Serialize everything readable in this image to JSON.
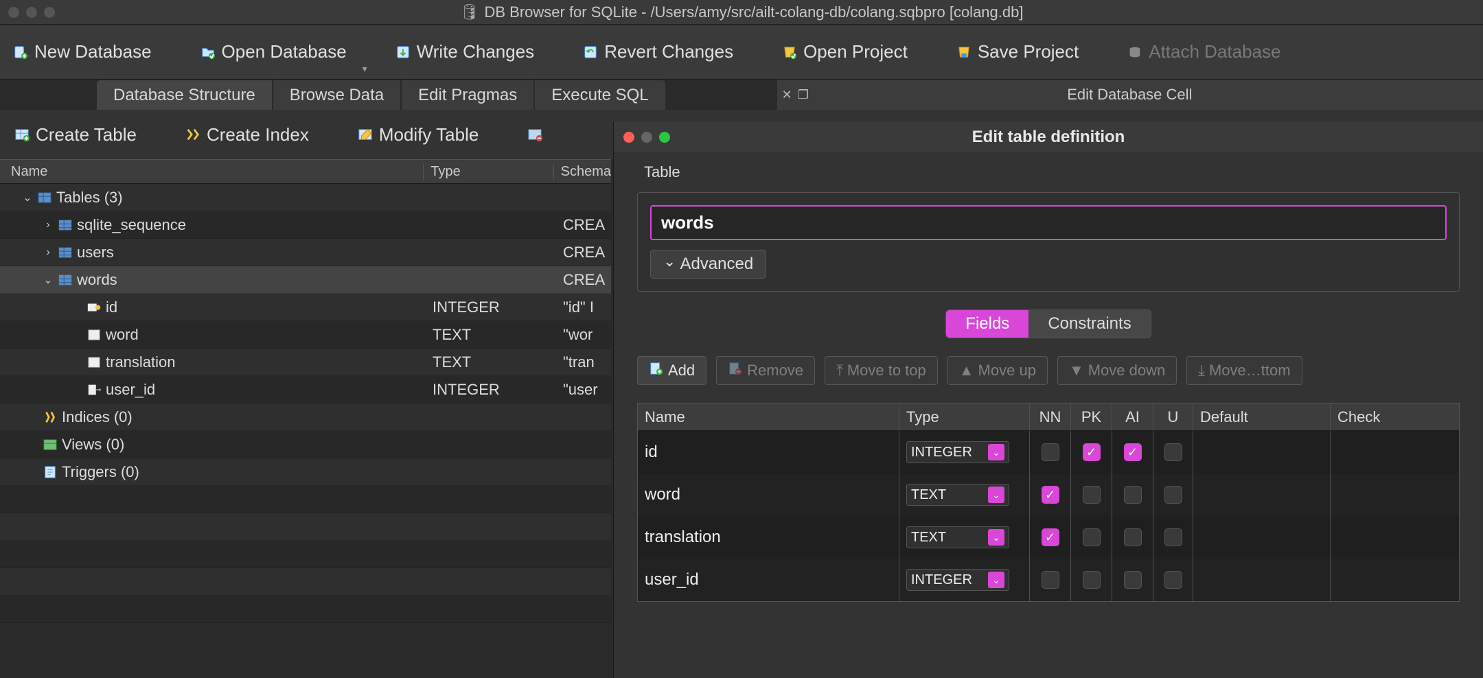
{
  "window": {
    "title": "DB Browser for SQLite - /Users/amy/src/ailt-colang-db/colang.sqbpro [colang.db]"
  },
  "toolbar": {
    "new_db": "New Database",
    "open_db": "Open Database",
    "write_changes": "Write Changes",
    "revert_changes": "Revert Changes",
    "open_project": "Open Project",
    "save_project": "Save Project",
    "attach_db": "Attach Database"
  },
  "tabs": {
    "structure": "Database Structure",
    "browse": "Browse Data",
    "pragmas": "Edit Pragmas",
    "sql": "Execute SQL",
    "right_panel": "Edit Database Cell"
  },
  "subtoolbar": {
    "create_table": "Create Table",
    "create_index": "Create Index",
    "modify_table": "Modify Table"
  },
  "schema": {
    "headers": {
      "name": "Name",
      "type": "Type",
      "schema": "Schema"
    },
    "tables_label": "Tables (3)",
    "tables": [
      {
        "name": "sqlite_sequence",
        "type": "",
        "schema": "CREA"
      },
      {
        "name": "users",
        "type": "",
        "schema": "CREA"
      },
      {
        "name": "words",
        "type": "",
        "schema": "CREA",
        "expanded": true,
        "columns": [
          {
            "name": "id",
            "type": "INTEGER",
            "schema": "\"id\" I"
          },
          {
            "name": "word",
            "type": "TEXT",
            "schema": "\"wor"
          },
          {
            "name": "translation",
            "type": "TEXT",
            "schema": "\"tran"
          },
          {
            "name": "user_id",
            "type": "INTEGER",
            "schema": "\"user"
          }
        ]
      }
    ],
    "indices": "Indices (0)",
    "views": "Views (0)",
    "triggers": "Triggers (0)"
  },
  "modal": {
    "title": "Edit table definition",
    "section_label": "Table",
    "table_name": "words",
    "advanced": "Advanced",
    "tab_fields": "Fields",
    "tab_constraints": "Constraints",
    "buttons": {
      "add": "Add",
      "remove": "Remove",
      "move_top": "Move to top",
      "move_up": "Move up",
      "move_down": "Move down",
      "move_bottom": "Move…ttom"
    },
    "cols": {
      "name": "Name",
      "type": "Type",
      "nn": "NN",
      "pk": "PK",
      "ai": "AI",
      "u": "U",
      "def": "Default",
      "chk": "Check"
    },
    "fields": [
      {
        "name": "id",
        "type": "INTEGER",
        "nn": false,
        "pk": true,
        "ai": true,
        "u": false
      },
      {
        "name": "word",
        "type": "TEXT",
        "nn": true,
        "pk": false,
        "ai": false,
        "u": false
      },
      {
        "name": "translation",
        "type": "TEXT",
        "nn": true,
        "pk": false,
        "ai": false,
        "u": false
      },
      {
        "name": "user_id",
        "type": "INTEGER",
        "nn": false,
        "pk": false,
        "ai": false,
        "u": false
      }
    ]
  }
}
